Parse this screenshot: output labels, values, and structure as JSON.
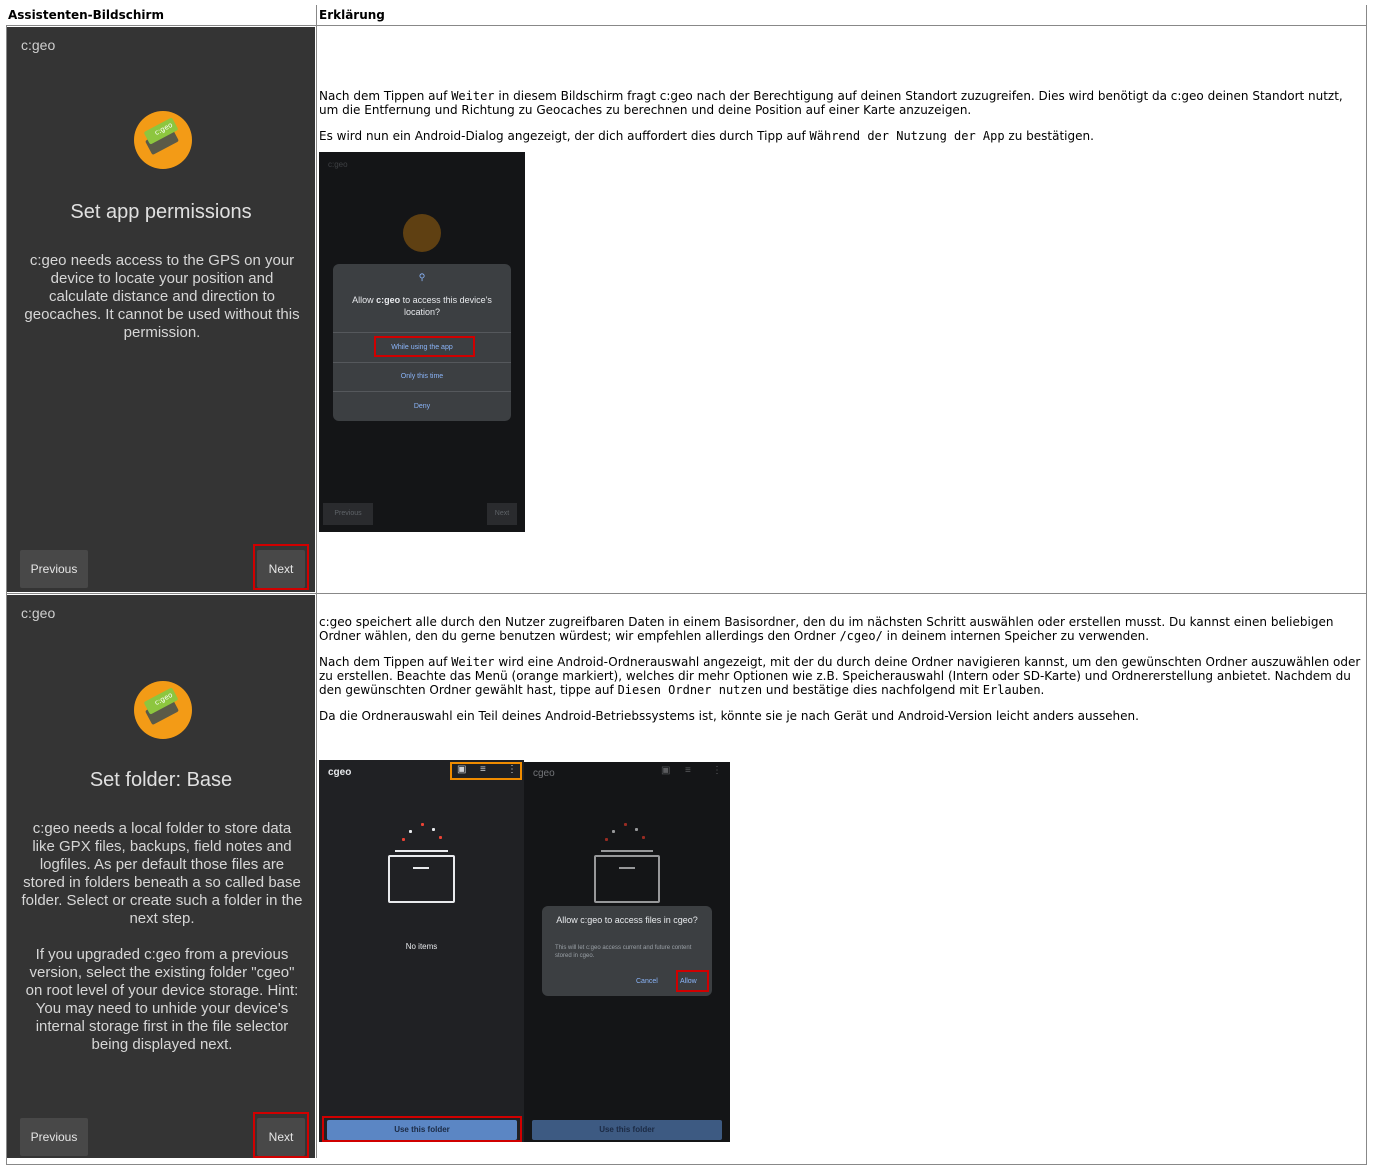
{
  "table": {
    "header_screen": "Assistenten-Bildschirm",
    "header_explanation": "Erklärung"
  },
  "row1": {
    "phone": {
      "app_title": "c:geo",
      "logo_text": "c:geo",
      "heading": "Set app permissions",
      "body": "c:geo needs access to the GPS on your device to locate your position and calculate distance and direction to geocaches. It cannot be used without this permission.",
      "previous": "Previous",
      "next": "Next"
    },
    "explanation": {
      "p1_pre": "Nach dem Tippen auf ",
      "p1_code": "Weiter",
      "p1_post": " in diesem Bildschirm fragt c:geo nach der Berechtigung auf deinen Standort zuzugreifen. Dies wird benötigt da c:geo deinen Standort nutzt, um die Entfernung und Richtung zu Geocaches zu berechnen und deine Position auf einer Karte anzuzeigen.",
      "p2_pre": "Es wird nun ein Android-Dialog angezeigt, der dich auffordert dies durch Tipp auf ",
      "p2_code": "Während der Nutzung der App",
      "p2_post": " zu bestätigen."
    },
    "screenshot": {
      "app_title": "c:geo",
      "dialog_title_pre": "Allow ",
      "dialog_title_app": "c:geo",
      "dialog_title_post": " to access this device's location?",
      "btn_while": "While using the app",
      "btn_once": "Only this time",
      "btn_deny": "Deny",
      "previous": "Previous",
      "next": "Next"
    }
  },
  "row2": {
    "phone": {
      "app_title": "c:geo",
      "logo_text": "c:geo",
      "heading": "Set folder: Base",
      "body1": "c:geo needs a local folder to store data like GPX files, backups, field notes and logfiles. As per default those files are stored in folders beneath a so called base folder. Select or create such a folder in the next step.",
      "body2": "If you upgraded c:geo from a previous version, select the existing folder \"cgeo\" on root level of your device storage. Hint: You may need to unhide your device's internal storage first in the file selector being displayed next.",
      "previous": "Previous",
      "next": "Next"
    },
    "explanation": {
      "p1_pre": "c:geo speichert alle durch den Nutzer zugreifbaren Daten in einem Basisordner, den du im nächsten Schritt auswählen oder erstellen musst. Du kannst einen beliebigen Ordner wählen, den du gerne benutzen würdest; wir empfehlen allerdings den Ordner ",
      "p1_code": "/cgeo/",
      "p1_post": " in deinem internen Speicher zu verwenden.",
      "p2_pre": "Nach dem Tippen auf ",
      "p2_code": "Weiter",
      "p2_mid": " wird eine Android-Ordnerauswahl angezeigt, mit der du durch deine Ordner navigieren kannst, um den gewünschten Ordner auszuwählen oder zu erstellen. Beachte das Menü (orange markiert), welches dir mehr Optionen wie z.B. Speicherauswahl (Intern oder SD-Karte) und Ordnererstellung anbietet. Nachdem du den gewünschten Ordner gewählt hast, tippe auf ",
      "p2_code2": "Diesen Ordner nutzen",
      "p2_mid2": " und bestätige dies nachfolgend mit ",
      "p2_code3": "Erlauben",
      "p2_post": ".",
      "p3": "Da die Ordnerauswahl ein Teil deines Android-Betriebssystems ist, könnte sie je nach Gerät und Android-Version leicht anders aussehen."
    },
    "screenshot_a": {
      "folder_name": "cgeo",
      "empty": "No items",
      "use_button": "Use this folder"
    },
    "screenshot_b": {
      "folder_name": "cgeo",
      "dialog_title": "Allow c:geo to access files in cgeo?",
      "dialog_body": "This will let c:geo access current and future content stored in cgeo.",
      "cancel": "Cancel",
      "allow": "Allow",
      "use_button": "Use this folder"
    }
  }
}
